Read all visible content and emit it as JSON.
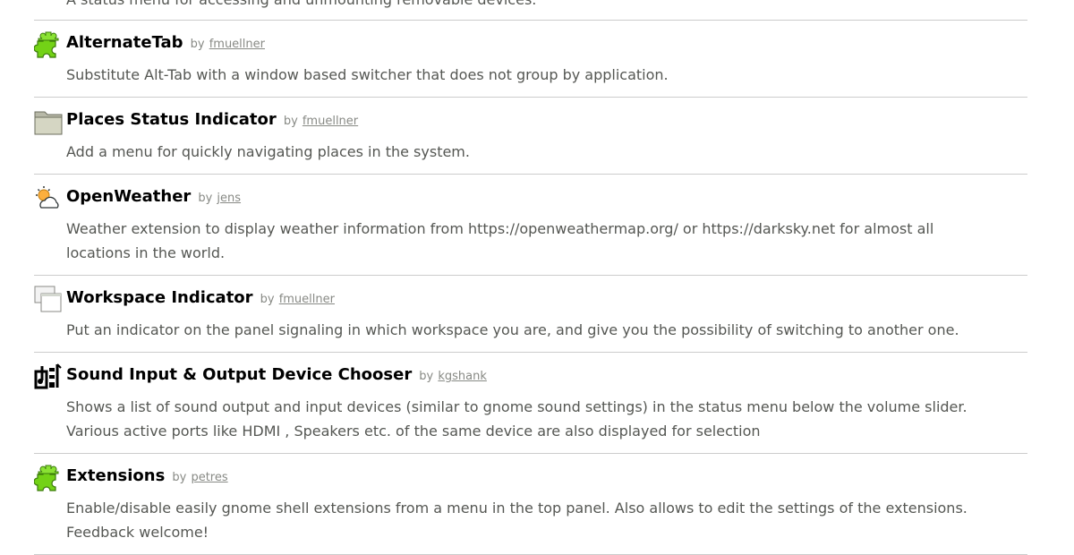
{
  "extensions_list": {
    "partial_top_description": "A status menu for accessing and unmounting removable devices.",
    "items": [
      {
        "icon": "puzzle-icon",
        "name": "AlternateTab",
        "by": "by",
        "author": "fmuellner",
        "description": "Substitute Alt-Tab with a window based switcher that does not group by application."
      },
      {
        "icon": "folder-icon",
        "name": "Places Status Indicator",
        "by": "by",
        "author": "fmuellner",
        "description": "Add a menu for quickly navigating places in the system."
      },
      {
        "icon": "weather-icon",
        "name": "OpenWeather",
        "by": "by",
        "author": "jens",
        "description": "Weather extension to display weather information from https://openweathermap.org/ or https://darksky.net for almost all locations in the world."
      },
      {
        "icon": "workspace-icon",
        "name": "Workspace Indicator",
        "by": "by",
        "author": "fmuellner",
        "description": "Put an indicator on the panel signaling in which workspace you are, and give you the possibility of switching to another one."
      },
      {
        "icon": "sound-device-icon",
        "name": "Sound Input & Output Device Chooser",
        "by": "by",
        "author": "kgshank",
        "description": "Shows a list of sound output and input devices (similar to gnome sound settings) in the status menu below the volume slider. Various active ports like HDMI , Speakers etc. of the same device are also displayed for selection"
      },
      {
        "icon": "puzzle-icon",
        "name": "Extensions",
        "by": "by",
        "author": "petres",
        "description": "Enable/disable easily gnome shell extensions from a menu in the top panel. Also allows to edit the settings of the extensions. Feedback welcome!"
      }
    ]
  }
}
